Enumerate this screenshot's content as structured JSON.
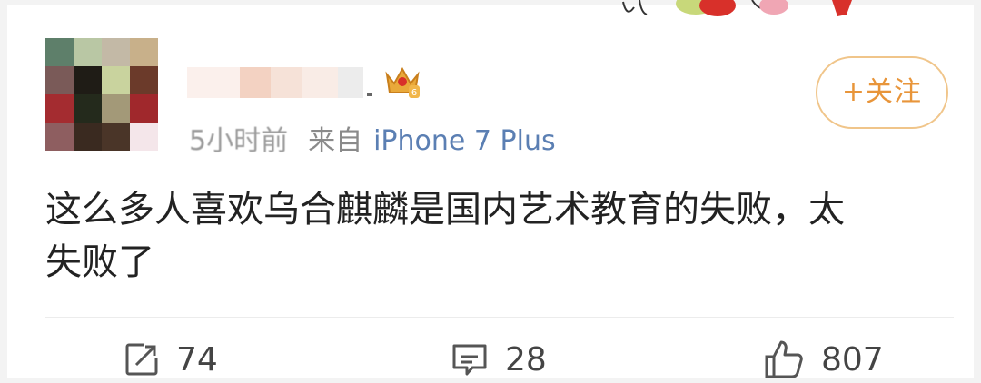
{
  "post": {
    "author": {
      "name": "",
      "avatar": "avatar-pixelated",
      "badge": "crown-badge",
      "badge_level": "6"
    },
    "time": "5小时前",
    "source_prefix": "来自",
    "source": "iPhone 7 Plus",
    "follow_label": "+关注",
    "content_line1": "这么多人喜欢乌合麒麟是国内艺术教育的失败，太",
    "content_line2": "失败了",
    "actions": {
      "share": {
        "icon": "share-icon",
        "count": "74"
      },
      "comment": {
        "icon": "comment-icon",
        "count": "28"
      },
      "like": {
        "icon": "thumbs-up-icon",
        "count": "807"
      }
    }
  },
  "colors": {
    "follow_border": "#f0c58a",
    "follow_text": "#e8953a",
    "source_link": "#5b7fb3",
    "text": "#222222",
    "meta": "#8a8a8a"
  }
}
